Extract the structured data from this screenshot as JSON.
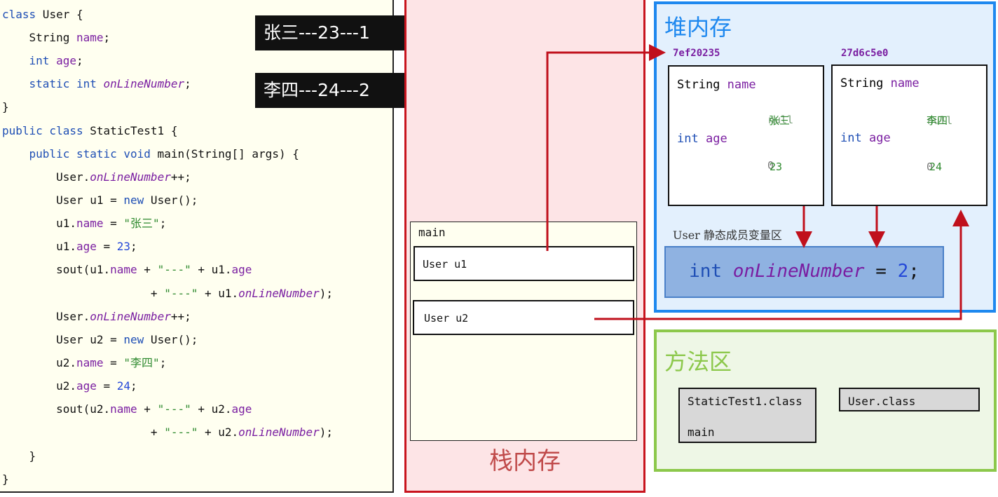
{
  "code": [
    [
      [
        "kw",
        "class"
      ],
      [
        "t",
        " User {"
      ]
    ],
    [
      [
        "t",
        "    String "
      ],
      [
        "fld",
        "name"
      ],
      [
        "t",
        ";"
      ]
    ],
    [
      [
        "t",
        "    "
      ],
      [
        "kw",
        "int"
      ],
      [
        "t",
        " "
      ],
      [
        "fld",
        "age"
      ],
      [
        "t",
        ";"
      ]
    ],
    [
      [
        "t",
        "    "
      ],
      [
        "kw",
        "static int"
      ],
      [
        "t",
        " "
      ],
      [
        "sfld",
        "onLineNumber"
      ],
      [
        "t",
        ";"
      ]
    ],
    [
      [
        "t",
        "}"
      ]
    ],
    [
      [
        "kw",
        "public class"
      ],
      [
        "t",
        " StaticTest1 {"
      ]
    ],
    [
      [
        "t",
        "    "
      ],
      [
        "kw",
        "public static void"
      ],
      [
        "t",
        " main(String[] args) {"
      ]
    ],
    [
      [
        "t",
        "        User."
      ],
      [
        "sfld",
        "onLineNumber"
      ],
      [
        "t",
        "++;"
      ]
    ],
    [
      [
        "t",
        "        User u1 = "
      ],
      [
        "kw",
        "new"
      ],
      [
        "t",
        " User();"
      ]
    ],
    [
      [
        "t",
        "        u1."
      ],
      [
        "fld",
        "name"
      ],
      [
        "t",
        " = "
      ],
      [
        "str",
        "\"张三\""
      ],
      [
        "t",
        ";"
      ]
    ],
    [
      [
        "t",
        "        u1."
      ],
      [
        "fld",
        "age"
      ],
      [
        "t",
        " = "
      ],
      [
        "num",
        "23"
      ],
      [
        "t",
        ";"
      ]
    ],
    [
      [
        "t",
        "        sout(u1."
      ],
      [
        "fld",
        "name"
      ],
      [
        "t",
        " + "
      ],
      [
        "str",
        "\"---\""
      ],
      [
        "t",
        " + u1."
      ],
      [
        "fld",
        "age"
      ]
    ],
    [
      [
        "t",
        "                      + "
      ],
      [
        "str",
        "\"---\""
      ],
      [
        "t",
        " + u1."
      ],
      [
        "sfld",
        "onLineNumber"
      ],
      [
        "t",
        ");"
      ]
    ],
    [
      [
        "t",
        "        User."
      ],
      [
        "sfld",
        "onLineNumber"
      ],
      [
        "t",
        "++;"
      ]
    ],
    [
      [
        "t",
        "        User u2 = "
      ],
      [
        "kw",
        "new"
      ],
      [
        "t",
        " User();"
      ]
    ],
    [
      [
        "t",
        "        u2."
      ],
      [
        "fld",
        "name"
      ],
      [
        "t",
        " = "
      ],
      [
        "str",
        "\"李四\""
      ],
      [
        "t",
        ";"
      ]
    ],
    [
      [
        "t",
        "        u2."
      ],
      [
        "fld",
        "age"
      ],
      [
        "t",
        " = "
      ],
      [
        "num",
        "24"
      ],
      [
        "t",
        ";"
      ]
    ],
    [
      [
        "t",
        "        sout(u2."
      ],
      [
        "fld",
        "name"
      ],
      [
        "t",
        " + "
      ],
      [
        "str",
        "\"---\""
      ],
      [
        "t",
        " + u2."
      ],
      [
        "fld",
        "age"
      ]
    ],
    [
      [
        "t",
        "                      + "
      ],
      [
        "str",
        "\"---\""
      ],
      [
        "t",
        " + u2."
      ],
      [
        "sfld",
        "onLineNumber"
      ],
      [
        "t",
        ");"
      ]
    ],
    [
      [
        "t",
        "    }"
      ]
    ],
    [
      [
        "t",
        "}"
      ]
    ]
  ],
  "console": {
    "output1": "张三---23---1",
    "output2": "李四---24---2"
  },
  "stack": {
    "title": "栈内存",
    "frame_label": "main",
    "var1": "User u1",
    "var2": "User u2"
  },
  "heap": {
    "title": "堆内存",
    "objects": [
      {
        "address": "7ef20235",
        "field1_type": "String",
        "field1_name": "name",
        "field1_value": "张三",
        "field1_old": "null",
        "field2_type": "int",
        "field2_name": "age",
        "field2_value": "23",
        "field2_old": "0"
      },
      {
        "address": "27d6c5e0",
        "field1_type": "String",
        "field1_name": "name",
        "field1_value": "李四",
        "field1_old": "null",
        "field2_type": "int",
        "field2_name": "age",
        "field2_value": "24",
        "field2_old": "0"
      }
    ],
    "static_area_label": "User 静态成员变量区",
    "static_type": "int",
    "static_name": "onLineNumber",
    "static_eq": "=",
    "static_value": "2",
    "static_end": ";"
  },
  "method_area": {
    "title": "方法区",
    "class1_name": "StaticTest1.class",
    "class1_method": "main",
    "class2_name": "User.class"
  },
  "colors": {
    "stack": "#c8141e",
    "heap": "#1e88ef",
    "method": "#8cc84b",
    "arrow": "#c0101c"
  }
}
